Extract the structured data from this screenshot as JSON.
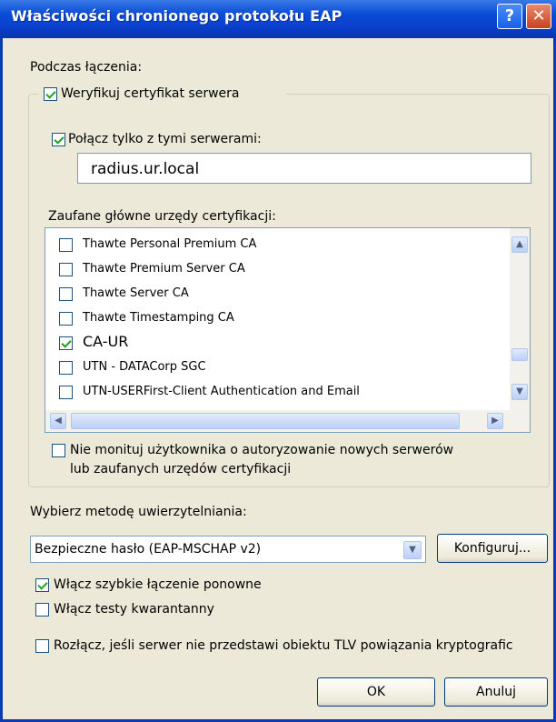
{
  "window": {
    "title": "Właściwości chronionego protokołu EAP",
    "help_icon": "?",
    "close_icon": "✕"
  },
  "connect_heading": "Podczas łączenia:",
  "verify_cert": {
    "label": "Weryfikuj certyfikat serwera",
    "checked": true
  },
  "connect_only": {
    "label": "Połącz tylko z tymi serwerami:",
    "checked": true
  },
  "servers_value": "radius.ur.local",
  "trusted_ca_label": "Zaufane główne urzędy certyfikacji:",
  "ca_list": [
    {
      "label": "Thawte Personal Premium CA",
      "checked": false
    },
    {
      "label": "Thawte Premium Server CA",
      "checked": false
    },
    {
      "label": "Thawte Server CA",
      "checked": false
    },
    {
      "label": "Thawte Timestamping CA",
      "checked": false
    },
    {
      "label": "CA-UR",
      "checked": true
    },
    {
      "label": "UTN - DATACorp SGC",
      "checked": false
    },
    {
      "label": "UTN-USERFirst-Client Authentication and Email",
      "checked": false
    }
  ],
  "no_prompt": {
    "line1": "Nie monituj użytkownika o autoryzowanie nowych serwerów",
    "line2": "lub zaufanych urzędów certyfikacji",
    "checked": false
  },
  "auth_method_label": "Wybierz metodę uwierzytelniania:",
  "auth_method_value": "Bezpieczne hasło (EAP-MSCHAP v2)",
  "configure_button": "Konfiguruj...",
  "fast_reconnect": {
    "label": "Włącz szybkie łączenie ponowne",
    "checked": true
  },
  "quarantine": {
    "label": "Włącz testy kwarantanny",
    "checked": false
  },
  "disconnect": {
    "label": "Rozłącz, jeśli serwer nie przedstawi obiektu TLV powiązania kryptografic",
    "checked": false
  },
  "ok_button": "OK",
  "cancel_button": "Anuluj"
}
